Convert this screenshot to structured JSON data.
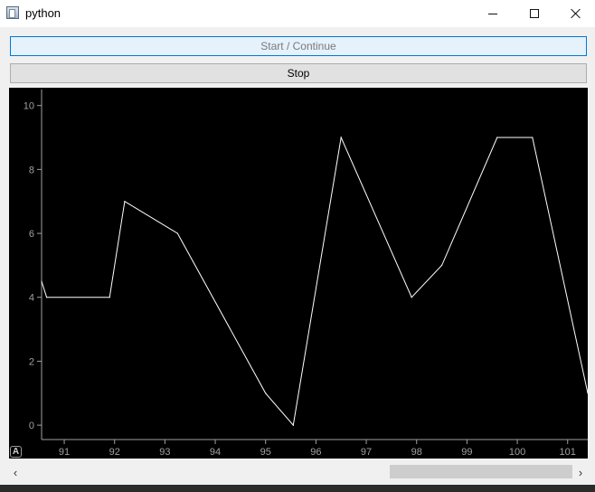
{
  "window": {
    "title": "python",
    "minimize_glyph": "—",
    "maximize_glyph": "☐",
    "close_glyph": "✕",
    "icon": "app-window-icon"
  },
  "buttons": {
    "start_label": "Start / Continue",
    "stop_label": "Stop"
  },
  "plot": {
    "auto_button_label": "A"
  },
  "scrollbar": {
    "left_arrow": "‹",
    "right_arrow": "›"
  },
  "colors": {
    "plot_background": "#000000",
    "line": "#ffffff",
    "axis": "#a0a0a0",
    "tick_text": "#a0a0a0"
  },
  "chart_data": {
    "type": "line",
    "x": [
      90.55,
      90.65,
      91.9,
      92.2,
      93.25,
      95.0,
      95.55,
      96.5,
      97.9,
      98.5,
      99.6,
      100.3,
      101.4
    ],
    "series": [
      {
        "values": [
          4.5,
          4.0,
          4.0,
          7.0,
          6.0,
          1.0,
          0.0,
          9.0,
          4.0,
          5.0,
          9.0,
          9.0,
          1.0
        ]
      }
    ],
    "xlim": [
      90.55,
      101.4
    ],
    "ylim": [
      -0.45,
      10.5
    ],
    "xticks": [
      91,
      92,
      93,
      94,
      95,
      96,
      97,
      98,
      99,
      100,
      101
    ],
    "yticks": [
      0,
      2,
      4,
      6,
      8,
      10
    ],
    "grid": false,
    "title": "",
    "xlabel": "",
    "ylabel": ""
  }
}
